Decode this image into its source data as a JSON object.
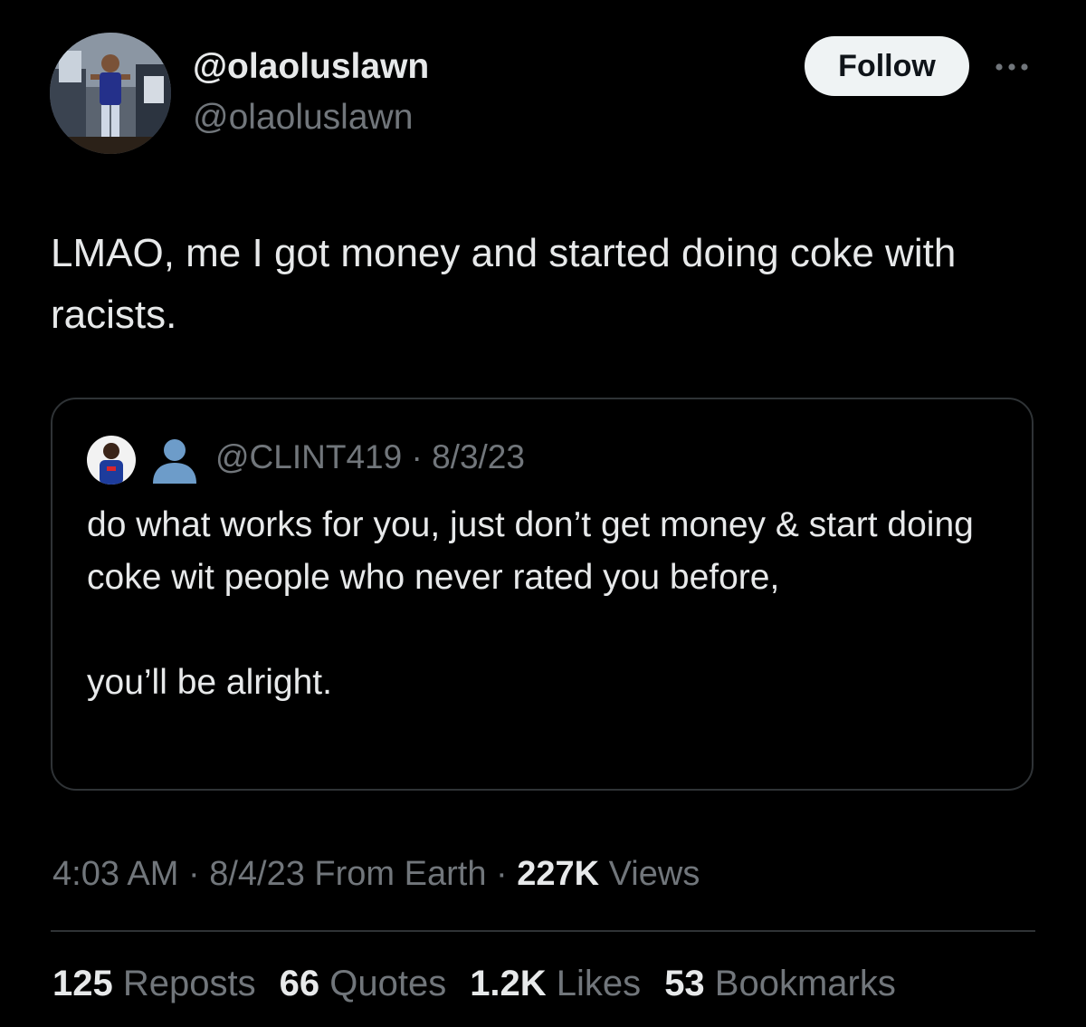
{
  "author": {
    "display_name": "@olaoluslawn",
    "handle": "@olaoluslawn",
    "avatar_icon": "profile-photo"
  },
  "follow_label": "Follow",
  "more_icon": "more-horizontal-icon",
  "tweet": {
    "text": "LMAO, me I got money and started doing coke with racists."
  },
  "quote": {
    "avatar_icon": "profile-photo",
    "user_icon": "person-silhouette-icon",
    "handle": "@CLINT419",
    "separator": " · ",
    "date": "8/3/23",
    "paragraph_1": "do what works for you, just don’t get money & start doing coke wit people who never rated you before,",
    "paragraph_2": "you’ll be alright."
  },
  "meta": {
    "time": "4:03 AM",
    "separator": " · ",
    "date_source": "8/4/23 From Earth",
    "views_count": "227K",
    "views_label": " Views"
  },
  "stats": [
    {
      "count": "125",
      "label": " Reposts"
    },
    {
      "count": "66",
      "label": " Quotes"
    },
    {
      "count": "1.2K",
      "label": " Likes"
    },
    {
      "count": "53",
      "label": " Bookmarks"
    }
  ],
  "colors": {
    "background": "#000000",
    "primary_text": "#e7e9ea",
    "secondary_text": "#71767b",
    "border": "#2f3336",
    "button_bg": "#eff3f4",
    "button_text": "#0f1419"
  }
}
